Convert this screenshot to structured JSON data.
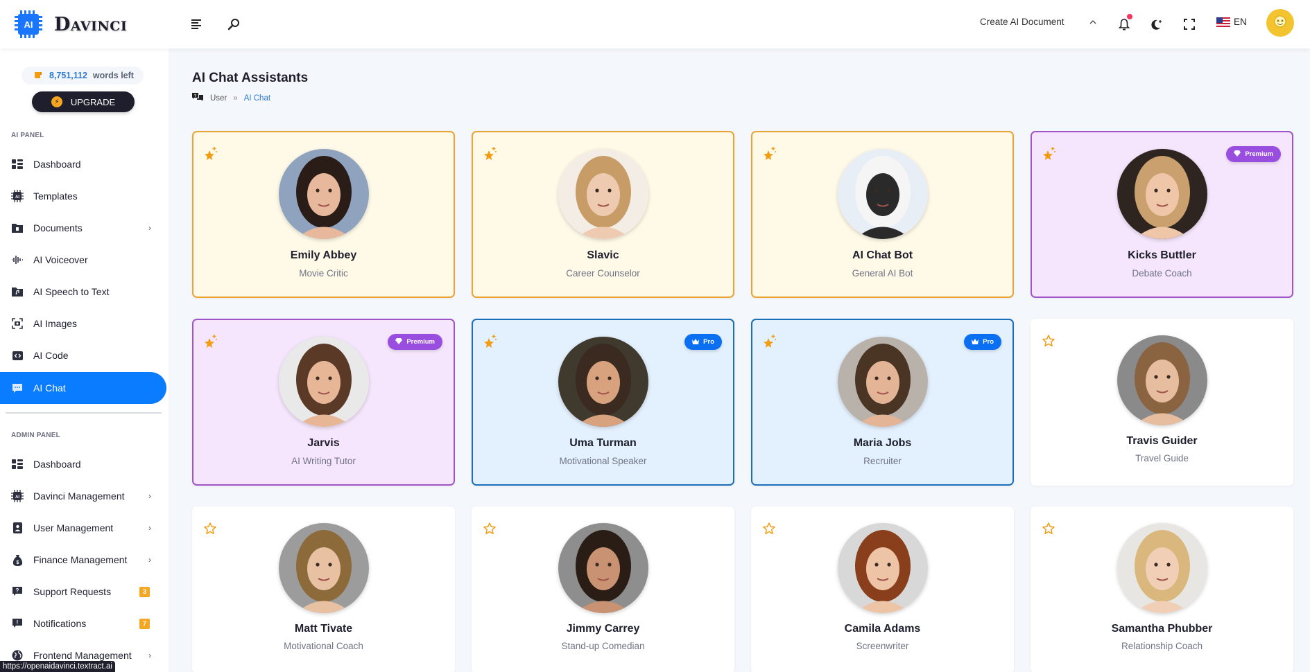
{
  "app": {
    "logo_chip_text": "AI",
    "logo_text": "Davinci"
  },
  "header": {
    "create_document_label": "Create AI Document",
    "language": "EN",
    "icons": [
      "menu-icon",
      "search-icon",
      "chevron-up-icon",
      "bell-icon",
      "dark-mode-icon",
      "fullscreen-icon",
      "us-flag-icon",
      "user-avatar"
    ]
  },
  "sidebar": {
    "words_left_count": "8,751,112",
    "words_left_label": "words left",
    "upgrade_label": "UPGRADE",
    "ai_panel_label": "AI PANEL",
    "ai_panel_items": [
      {
        "label": "Dashboard",
        "icon": "dashboard-icon",
        "has_chevron": false
      },
      {
        "label": "Templates",
        "icon": "ai-chip-icon",
        "has_chevron": false
      },
      {
        "label": "Documents",
        "icon": "folder-icon",
        "has_chevron": true
      },
      {
        "label": "AI Voiceover",
        "icon": "waveform-icon",
        "has_chevron": false
      },
      {
        "label": "AI Speech to Text",
        "icon": "music-file-icon",
        "has_chevron": false
      },
      {
        "label": "AI Images",
        "icon": "camera-icon",
        "has_chevron": false
      },
      {
        "label": "AI Code",
        "icon": "code-icon",
        "has_chevron": false
      },
      {
        "label": "AI Chat",
        "icon": "chat-icon",
        "has_chevron": false,
        "active": true
      }
    ],
    "admin_panel_label": "ADMIN PANEL",
    "admin_panel_items": [
      {
        "label": "Dashboard",
        "icon": "dashboard-icon"
      },
      {
        "label": "Davinci Management",
        "icon": "ai-chip-icon",
        "has_chevron": true
      },
      {
        "label": "User Management",
        "icon": "user-card-icon",
        "has_chevron": true
      },
      {
        "label": "Finance Management",
        "icon": "money-bag-icon",
        "has_chevron": true
      },
      {
        "label": "Support Requests",
        "icon": "question-chat-icon",
        "badge": "3"
      },
      {
        "label": "Notifications",
        "icon": "alert-chat-icon",
        "badge": "7"
      },
      {
        "label": "Frontend Management",
        "icon": "globe-icon",
        "has_chevron": true
      }
    ],
    "status_url": "https://openaidavinci.textract.ai"
  },
  "main": {
    "title": "AI Chat Assistants",
    "breadcrumb": {
      "root": "User",
      "separator": "»",
      "current": "AI Chat"
    },
    "assistants": [
      {
        "name": "Emily Abbey",
        "role": "Movie Critic",
        "style": "gold",
        "favorite": true,
        "tier": null
      },
      {
        "name": "Slavic",
        "role": "Career Counselor",
        "style": "gold",
        "favorite": true,
        "tier": null
      },
      {
        "name": "AI Chat Bot",
        "role": "General AI Bot",
        "style": "gold",
        "favorite": true,
        "tier": null
      },
      {
        "name": "Kicks Buttler",
        "role": "Debate Coach",
        "style": "purple",
        "favorite": true,
        "tier": "Premium"
      },
      {
        "name": "Jarvis",
        "role": "AI Writing Tutor",
        "style": "purple",
        "favorite": true,
        "tier": "Premium"
      },
      {
        "name": "Uma Turman",
        "role": "Motivational Speaker",
        "style": "blue",
        "favorite": true,
        "tier": "Pro"
      },
      {
        "name": "Maria Jobs",
        "role": "Recruiter",
        "style": "blue",
        "favorite": true,
        "tier": "Pro"
      },
      {
        "name": "Travis Guider",
        "role": "Travel Guide",
        "style": "plain",
        "favorite": false,
        "tier": null
      },
      {
        "name": "Matt Tivate",
        "role": "Motivational Coach",
        "style": "plain",
        "favorite": false,
        "tier": null
      },
      {
        "name": "Jimmy Carrey",
        "role": "Stand-up Comedian",
        "style": "plain",
        "favorite": false,
        "tier": null
      },
      {
        "name": "Camila Adams",
        "role": "Screenwriter",
        "style": "plain",
        "favorite": false,
        "tier": null
      },
      {
        "name": "Samantha Phubber",
        "role": "Relationship Coach",
        "style": "plain",
        "favorite": false,
        "tier": null
      }
    ]
  },
  "colors": {
    "accent_blue": "#0a7cff",
    "gold_border": "#eaa434",
    "gold_bg": "#fffae8",
    "purple_border": "#a055c7",
    "purple_bg": "#f6e6fd",
    "blue_border": "#1b6fb8",
    "blue_bg": "#e3f0fd",
    "premium_badge": "#9a4ee0",
    "pro_badge": "#0a6ff0",
    "star": "#f39c12",
    "badge_orange": "#f5a623"
  }
}
